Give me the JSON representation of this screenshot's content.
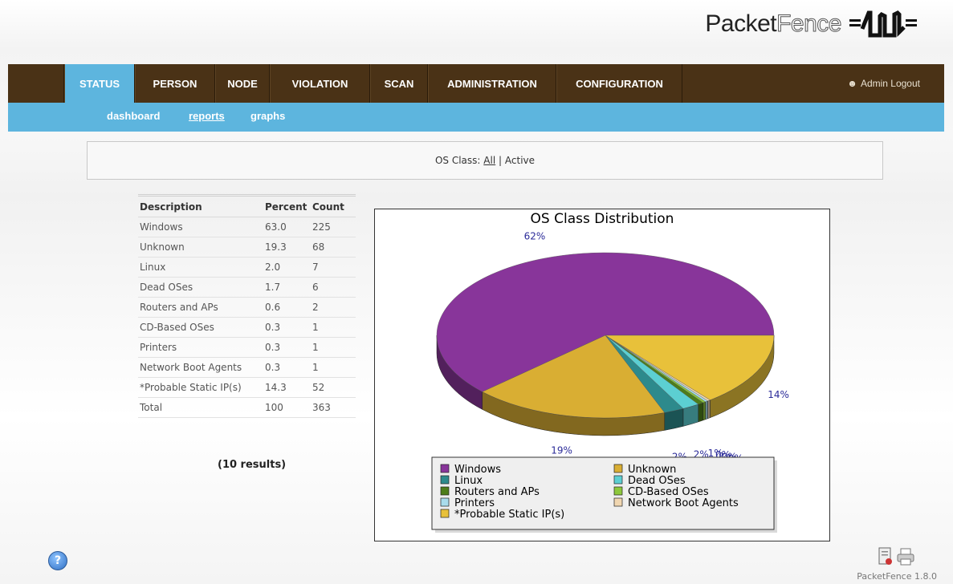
{
  "brand": {
    "name_dark": "Packet",
    "name_light": "Fence"
  },
  "nav": {
    "tabs": [
      "STATUS",
      "PERSON",
      "NODE",
      "VIOLATION",
      "SCAN",
      "ADMINISTRATION",
      "CONFIGURATION"
    ],
    "active": "STATUS",
    "user_text": "Admin Logout"
  },
  "subnav": {
    "items": [
      "dashboard",
      "reports",
      "graphs"
    ],
    "current": "reports"
  },
  "filter": {
    "label": "OS Class:",
    "all": "All",
    "separator": "|",
    "active": "Active"
  },
  "table": {
    "headers": [
      "Description",
      "Percent",
      "Count"
    ],
    "rows": [
      [
        "Windows",
        "63.0",
        "225"
      ],
      [
        "Unknown",
        "19.3",
        "68"
      ],
      [
        "Linux",
        "2.0",
        "7"
      ],
      [
        "Dead OSes",
        "1.7",
        "6"
      ],
      [
        "Routers and APs",
        "0.6",
        "2"
      ],
      [
        "CD-Based OSes",
        "0.3",
        "1"
      ],
      [
        "Printers",
        "0.3",
        "1"
      ],
      [
        "Network Boot Agents",
        "0.3",
        "1"
      ],
      [
        "*Probable Static IP(s)",
        "14.3",
        "52"
      ],
      [
        "Total",
        "100",
        "363"
      ]
    ],
    "results": "(10 results)"
  },
  "chart_data": {
    "type": "pie",
    "title": "OS Class Distribution",
    "categories": [
      "Windows",
      "Unknown",
      "Linux",
      "Dead OSes",
      "Routers and APs",
      "CD-Based OSes",
      "Printers",
      "Network Boot Agents",
      "*Probable Static IP(s)"
    ],
    "values": [
      225,
      68,
      7,
      6,
      2,
      1,
      1,
      1,
      52
    ],
    "value_labels": [
      "62%",
      "19%",
      "2%",
      "2%",
      "1%",
      "0%",
      "0%",
      "0%",
      "14%"
    ],
    "colors": [
      "#88359a",
      "#d9ae33",
      "#2d8a8c",
      "#5ccfd2",
      "#4d7d1a",
      "#8dc83c",
      "#a9dcec",
      "#f0d6b0",
      "#e8c13a"
    ],
    "legend_placement": "bottom"
  },
  "footer": {
    "version": "PacketFence 1.8.0",
    "help_symbol": "?"
  }
}
